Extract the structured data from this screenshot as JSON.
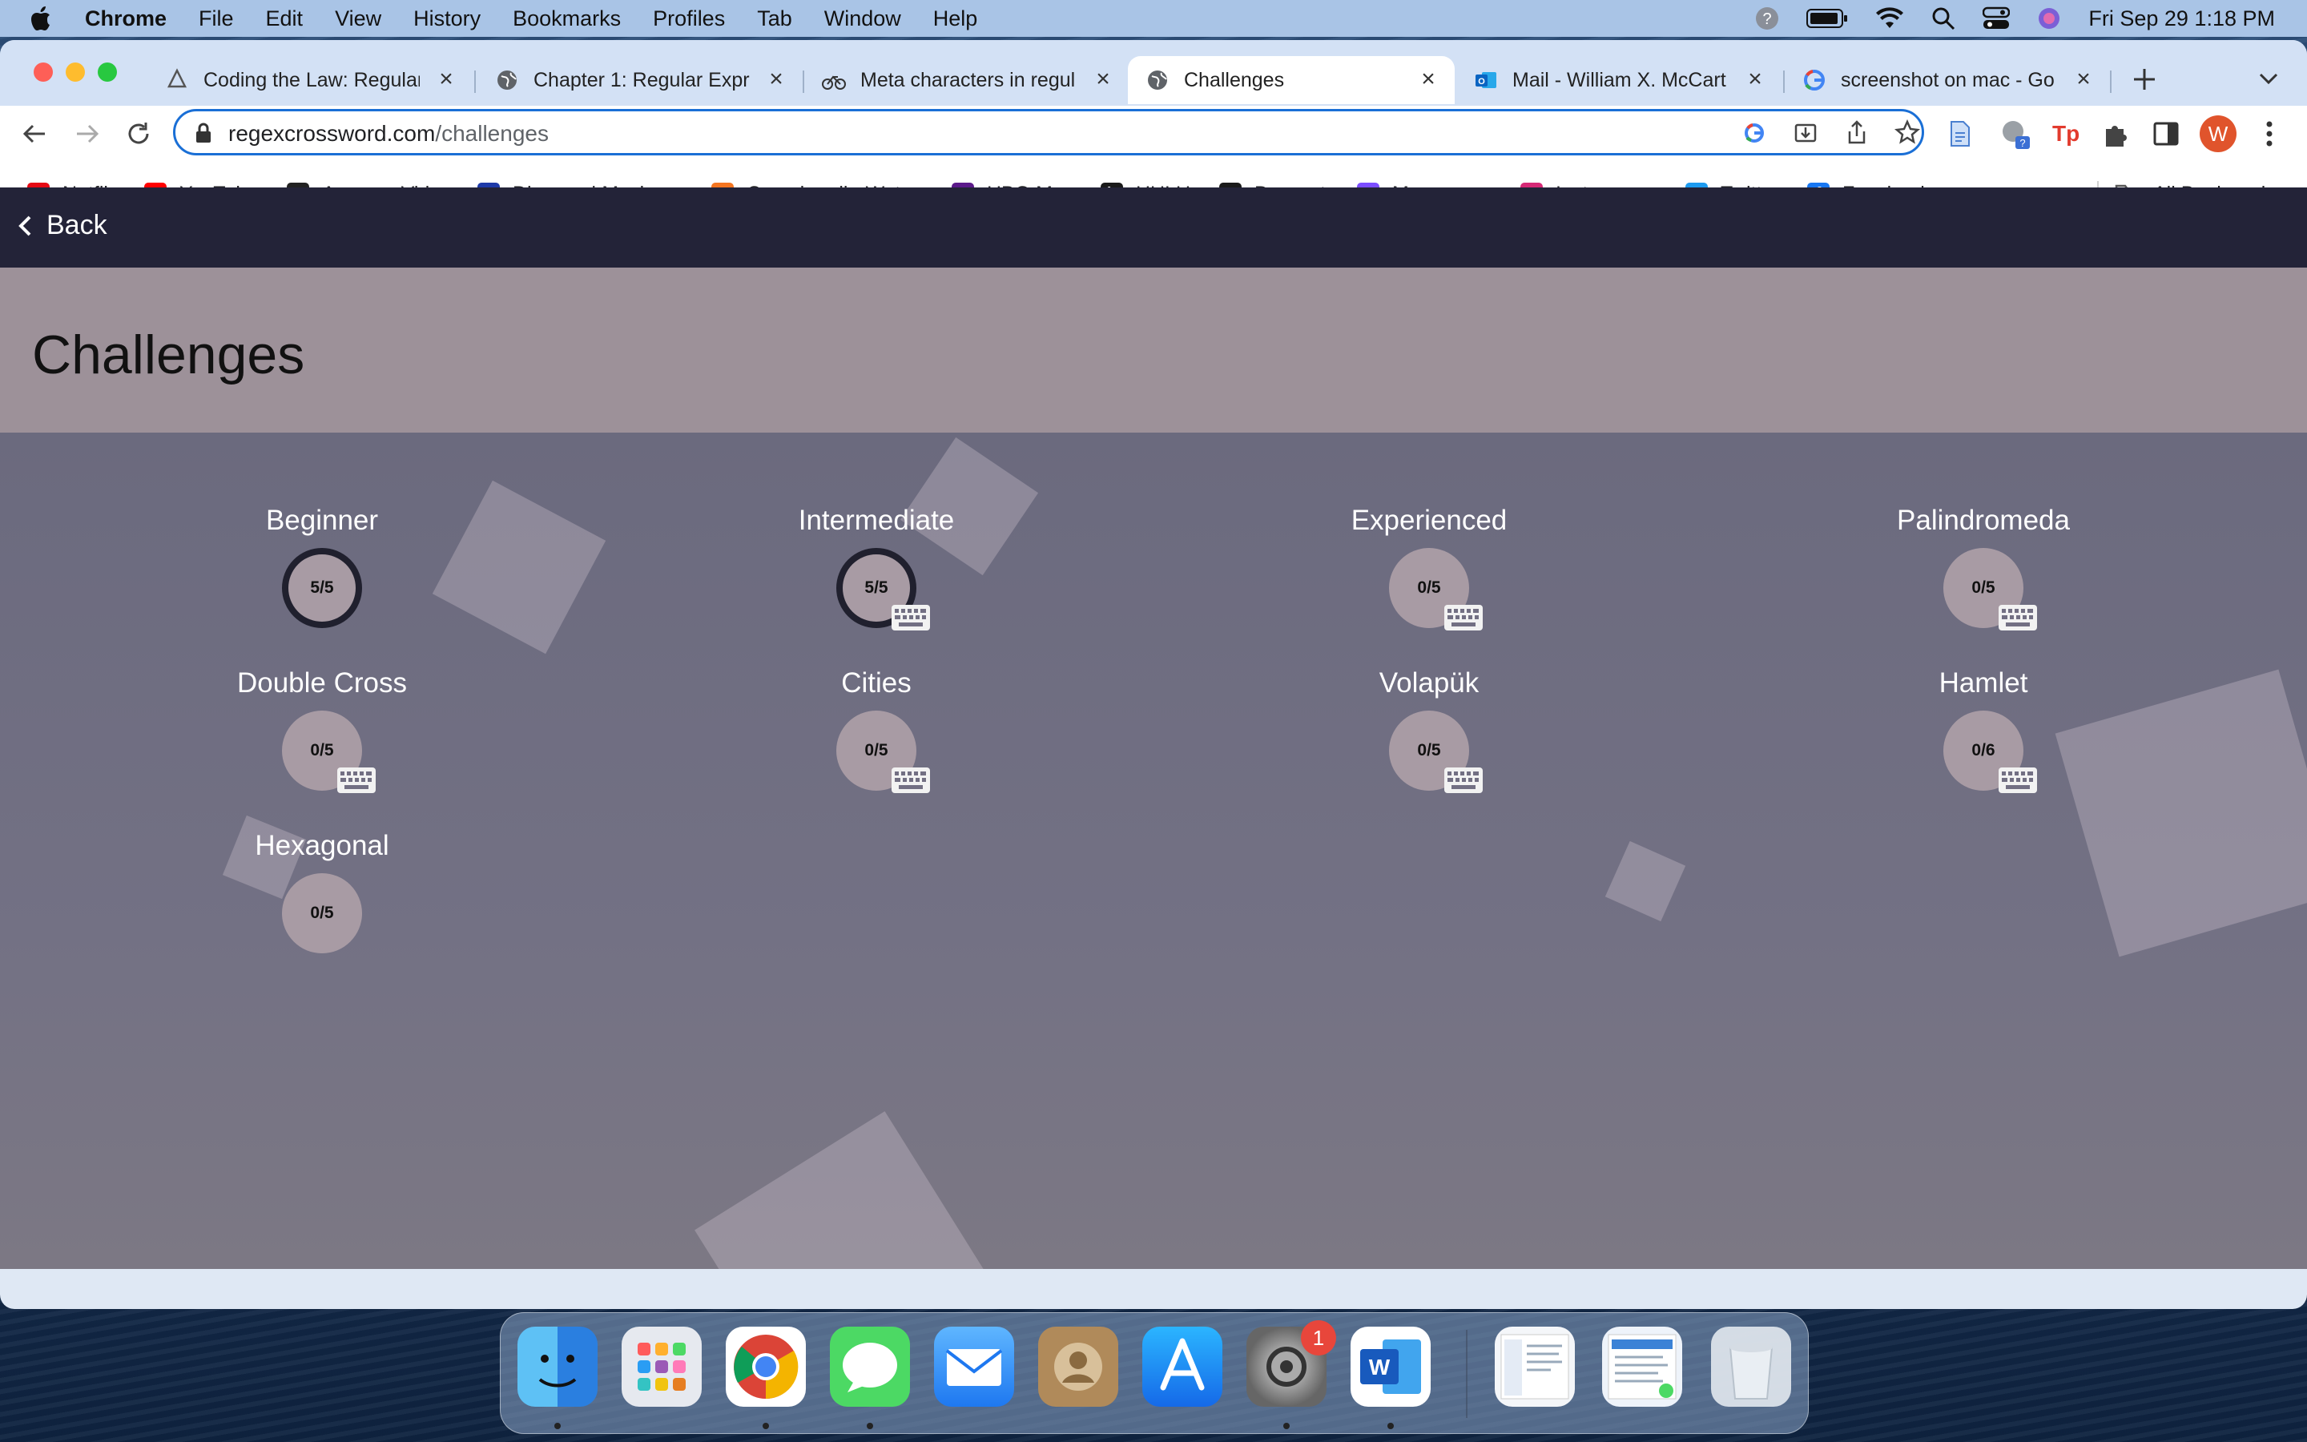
{
  "menubar": {
    "app": "Chrome",
    "items": [
      "File",
      "Edit",
      "View",
      "History",
      "Bookmarks",
      "Profiles",
      "Tab",
      "Window",
      "Help"
    ],
    "clock": "Fri Sep 29  1:18 PM"
  },
  "tabs": [
    {
      "title": "Coding the Law: Regular",
      "icon": "docs-icon"
    },
    {
      "title": "Chapter 1: Regular Expre",
      "icon": "globe-icon"
    },
    {
      "title": "Meta characters in regul",
      "icon": "bike-icon"
    },
    {
      "title": "Challenges",
      "icon": "globe-icon",
      "active": true
    },
    {
      "title": "Mail - William X. McCart",
      "icon": "outlook-icon"
    },
    {
      "title": "screenshot on mac - Go",
      "icon": "google-icon"
    }
  ],
  "address_bar": {
    "host": "regexcrossword.com",
    "path": "/challenges"
  },
  "bookmarks": {
    "items": [
      {
        "label": "Netflix",
        "badge": "N",
        "color": "#e50914"
      },
      {
        "label": "YouTube",
        "badge": "▶",
        "color": "#ff0000"
      },
      {
        "label": "Amazon Video",
        "badge": "a",
        "color": "#222222"
      },
      {
        "label": "Disney+ | Movies...",
        "badge": "D",
        "color": "#1e3aa8"
      },
      {
        "label": "Crunchyroll - Wat...",
        "badge": "C",
        "color": "#f47521"
      },
      {
        "label": "HBO Max",
        "badge": "m",
        "color": "#5b1a8a"
      },
      {
        "label": "HULU",
        "badge": "h",
        "color": "#1a1a1a"
      },
      {
        "label": "Dropout",
        "badge": "D",
        "color": "#1a1a1a"
      },
      {
        "label": "Messenger",
        "badge": "m",
        "color": "#7b4dff"
      },
      {
        "label": "Instagram",
        "badge": "◎",
        "color": "#d62976"
      },
      {
        "label": "Twitter",
        "badge": "t",
        "color": "#1d9bf0"
      },
      {
        "label": "Facebook",
        "badge": "f",
        "color": "#1877f2"
      }
    ],
    "overflow": "»",
    "all_bookmarks": "All Bookmarks"
  },
  "site": {
    "back_label": "Back",
    "page_title": "Challenges"
  },
  "challenges": [
    {
      "name": "Beginner",
      "progress": "5/5",
      "completed": true,
      "keyboard": false
    },
    {
      "name": "Intermediate",
      "progress": "5/5",
      "completed": true,
      "keyboard": true
    },
    {
      "name": "Experienced",
      "progress": "0/5",
      "completed": false,
      "keyboard": true
    },
    {
      "name": "Palindromeda",
      "progress": "0/5",
      "completed": false,
      "keyboard": true
    },
    {
      "name": "Double Cross",
      "progress": "0/5",
      "completed": false,
      "keyboard": true
    },
    {
      "name": "Cities",
      "progress": "0/5",
      "completed": false,
      "keyboard": true
    },
    {
      "name": "Volapük",
      "progress": "0/5",
      "completed": false,
      "keyboard": true
    },
    {
      "name": "Hamlet",
      "progress": "0/6",
      "completed": false,
      "keyboard": true
    },
    {
      "name": "Hexagonal",
      "progress": "0/5",
      "completed": false,
      "keyboard": false
    }
  ],
  "dock": {
    "apps": [
      "finder-icon",
      "launchpad-icon",
      "chrome-icon",
      "messages-icon",
      "mail-icon",
      "contacts-icon",
      "app-store-icon",
      "system-settings-icon",
      "word-icon",
      "screenshot-thumbnail-1",
      "screenshot-thumbnail-2",
      "trash-icon"
    ],
    "settings_badge": "1"
  },
  "colors": {
    "site_header": "#232338",
    "title_band": "#9d9199",
    "page_background": "#726f83",
    "progress_circle": "#a89ba4",
    "completed_ring": "#20202e",
    "omnibox_focus": "#1a6fd6"
  }
}
